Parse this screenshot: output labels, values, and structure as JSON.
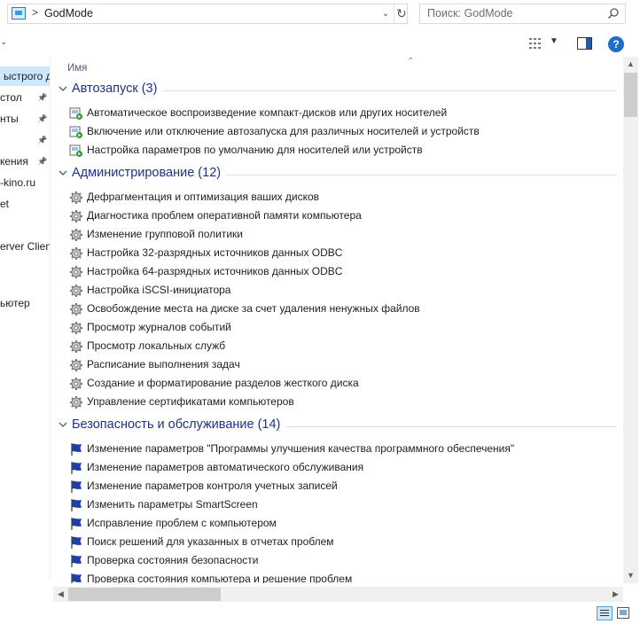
{
  "address": {
    "path_label": "GodMode",
    "separator": ">"
  },
  "search": {
    "placeholder": "Поиск: GodMode"
  },
  "toolbar": {
    "help_label": "?"
  },
  "nav": {
    "items": [
      {
        "label": "ыстрого до",
        "selected": true,
        "pinned": false
      },
      {
        "label": "стол",
        "pinned": true
      },
      {
        "label": "нты",
        "pinned": true
      },
      {
        "label": "",
        "pinned": true
      },
      {
        "label": "кения",
        "pinned": true
      },
      {
        "label": "-kino.ru",
        "pinned": false
      },
      {
        "label": "et",
        "pinned": false
      },
      {
        "label": "",
        "pinned": false
      },
      {
        "label": "erver Clien",
        "pinned": false
      },
      {
        "label": "",
        "pinned": false
      },
      {
        "label": "ьютер",
        "pinned": false
      }
    ]
  },
  "list": {
    "column_header": "Имя",
    "groups": [
      {
        "title": "Автозапуск (3)",
        "icon": "autoplay-icon",
        "items": [
          "Автоматическое воспроизведение компакт-дисков или других носителей",
          "Включение или отключение автозапуска для различных носителей и устройств",
          "Настройка параметров по умолчанию для носителей или устройств"
        ]
      },
      {
        "title": "Администрирование (12)",
        "icon": "admin-tools-icon",
        "items": [
          "Дефрагментация и оптимизация ваших дисков",
          "Диагностика проблем оперативной памяти компьютера",
          "Изменение групповой политики",
          "Настройка 32-разрядных источников данных ODBC",
          "Настройка 64-разрядных источников данных ODBC",
          "Настройка iSCSI-инициатора",
          "Освобождение места на диске за счет удаления ненужных файлов",
          "Просмотр журналов событий",
          "Просмотр локальных служб",
          "Расписание выполнения задач",
          "Создание и форматирование разделов жесткого диска",
          "Управление сертификатами компьютеров"
        ]
      },
      {
        "title": "Безопасность и обслуживание (14)",
        "icon": "security-flag-icon",
        "items": [
          "Изменение параметров \"Программы улучшения качества программного обеспечения\"",
          "Изменение параметров автоматического обслуживания",
          "Изменение параметров контроля учетных записей",
          "Изменить параметры SmartScreen",
          "Исправление проблем с компьютером",
          "Поиск решений для указанных в отчетах проблем",
          "Проверка состояния безопасности",
          "Проверка состояния компьютера и решение проблем"
        ]
      }
    ]
  },
  "colors": {
    "group_title": "#1e3287",
    "selection": "#cce8ff",
    "flag": "#1e3fa8"
  }
}
